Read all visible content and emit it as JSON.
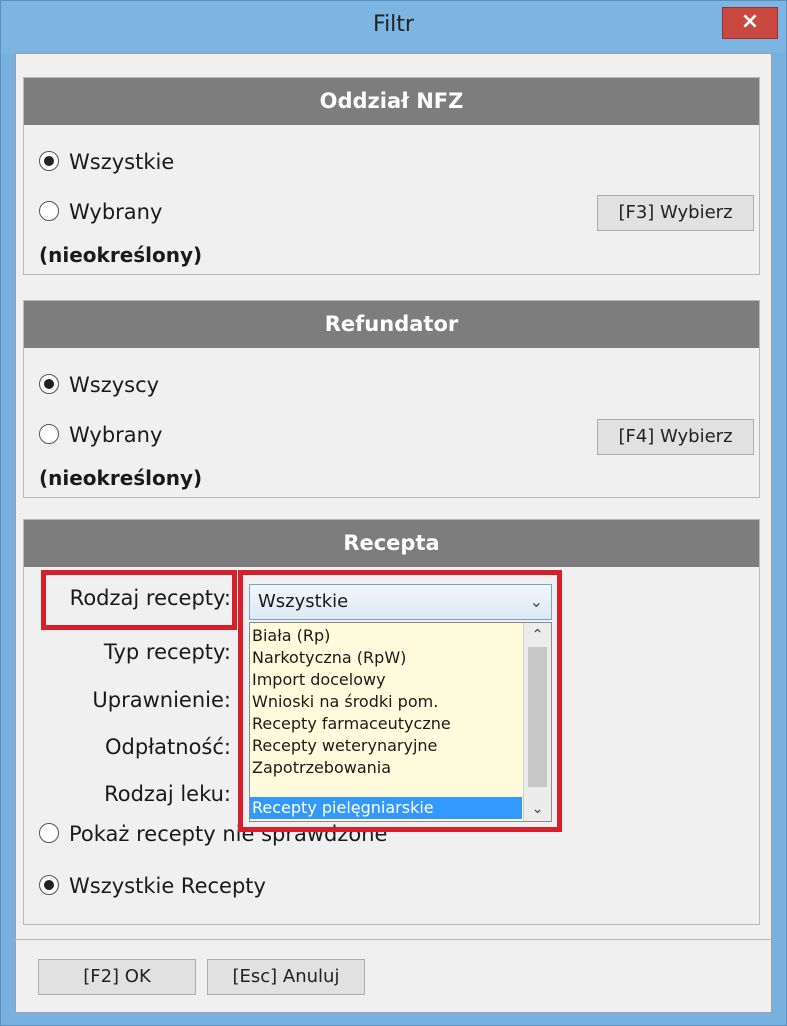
{
  "window": {
    "title": "Filtr",
    "close_glyph": "×"
  },
  "nfz": {
    "header": "Oddział NFZ",
    "option_all": "Wszystkie",
    "option_selected": "Wybrany",
    "selected_value": "(nieokreślony)",
    "choose_button": "[F3] Wybierz",
    "checked": "all"
  },
  "refundator": {
    "header": "Refundator",
    "option_all": "Wszyscy",
    "option_selected": "Wybrany",
    "selected_value": "(nieokreślony)",
    "choose_button": "[F4] Wybierz",
    "checked": "all"
  },
  "recepta": {
    "header": "Recepta",
    "labels": {
      "rodzaj_recepty": "Rodzaj recepty:",
      "typ_recepty": "Typ recepty:",
      "uprawnienie": "Uprawnienie:",
      "odplatnosc": "Odpłatność:",
      "rodzaj_leku": "Rodzaj leku:"
    },
    "rodzaj_select_value": "Wszystkie",
    "dropdown_options": [
      "Biała (Rp)",
      "Narkotyczna (RpW)",
      "Import docelowy",
      "Wnioski na środki pom.",
      "Recepty farmaceutyczne",
      "Recepty weterynaryjne",
      "Zapotrzebowania",
      "Recepty pielęgniarskie"
    ],
    "dropdown_selected_index": 7,
    "option_unchecked": "Pokaż recepty nie sprawdzone",
    "option_all": "Wszystkie Recepty",
    "checked": "all"
  },
  "footer": {
    "ok_button": "[F2] OK",
    "cancel_button": "[Esc] Anuluj"
  },
  "colors": {
    "title_bar": "#7cb4e2",
    "section_header": "#7d7d7d",
    "highlight": "#d8202c",
    "dropdown_bg": "#fffbdc",
    "selection": "#3399ff",
    "close_button": "#c9483f"
  },
  "icons": {
    "close": "close-icon",
    "dropdown": "chevron-down-icon",
    "scroll_up": "chevron-up-icon",
    "scroll_down": "chevron-down-icon"
  }
}
